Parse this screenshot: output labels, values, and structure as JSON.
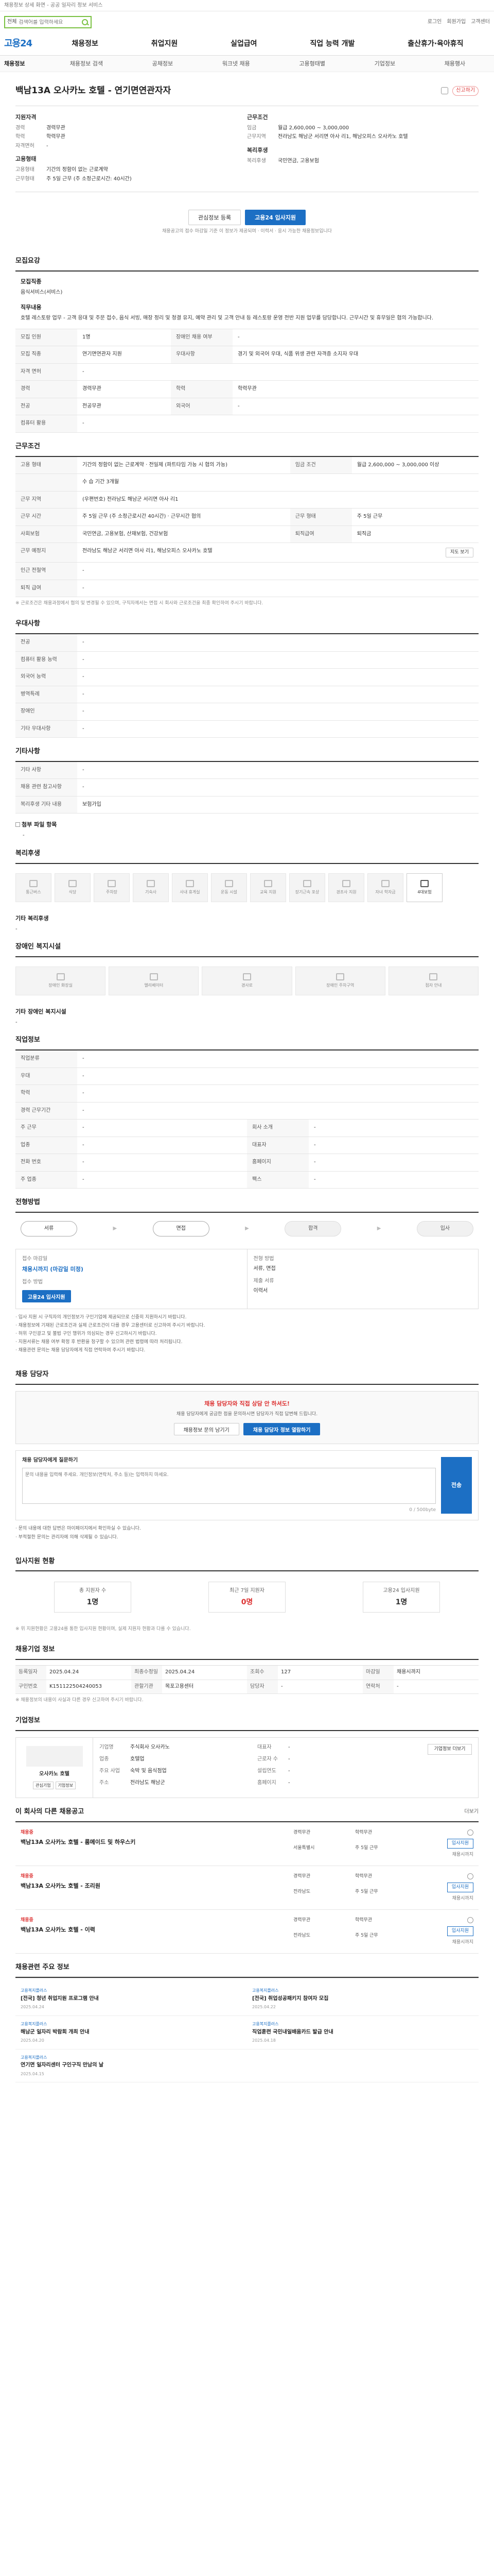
{
  "notice": "채용정보 상세 화면 - 공공 일자리 정보 서비스",
  "search": {
    "select": "전체",
    "placeholder": "검색어를 입력하세요"
  },
  "top_links": [
    "로그인",
    "회원가입",
    "고객센터"
  ],
  "logo": "고용24",
  "gnb": [
    "채용정보",
    "취업지원",
    "실업급여",
    "직업 능력 개발",
    "출산휴가·육아휴직"
  ],
  "subnav": {
    "first": "채용정보",
    "items": [
      "채용정보 검색",
      "공채정보",
      "워크넷 채용",
      "고용형태별",
      "기업정보",
      "채용행사"
    ]
  },
  "job": {
    "title": "백남13A 오사카노 호텔 - 연기면연관자자",
    "report": "신고하기",
    "summary_left_title": "지원자격",
    "summary_left": [
      {
        "k": "경력",
        "v": "경력무관"
      },
      {
        "k": "학력",
        "v": "학력무관"
      },
      {
        "k": "자격면허",
        "v": "-"
      }
    ],
    "summary_left2_title": "고용형태",
    "summary_left2": [
      {
        "k": "고용형태",
        "v": "기간의 정함이 없는 근로계약"
      },
      {
        "k": "근무형태",
        "v": "주 5일 근무 (주 소정근로시간: 40시간)"
      }
    ],
    "summary_right_title": "근무조건",
    "summary_right": [
      {
        "k": "임금",
        "v": "월급 2,600,000 ~ 3,000,000"
      },
      {
        "k": "근무지역",
        "v": "전라남도 해남군 서리면 아사 리1, 해남오피스 오사카노 호텔"
      }
    ],
    "summary_right2_title": "복리후생",
    "summary_right2": [
      {
        "k": "복리후생",
        "v": "국민연금, 고용보험"
      }
    ]
  },
  "deadline": {
    "scrap": "관심정보 등록",
    "apply": "고용24 입사지원",
    "note": "채용공고의 접수 마감일 기준 이 정보가 제공되며 · 이력서 · 응시 가능한 채용정보입니다"
  },
  "sections": {
    "recruit": "모집요강",
    "work": "근무조건",
    "welfare_detail": "우대사항",
    "etc": "기타사항",
    "welfare": "복리후생",
    "disabled": "장애인 복지시설",
    "company_form": "직업정보",
    "process": "전형방법",
    "inquiry": "채용 담당자",
    "stats": "입사지원 현황",
    "info": "채용기업 정보",
    "company": "기업정보",
    "other": "이 회사의 다른 채용공고",
    "news": "채용관련 주요 정보"
  },
  "recruit_table": {
    "job_title_label": "모집직종",
    "job_title": "음식서비스(서비스)",
    "desc_label": "직무내용",
    "desc": "호텔 레스토랑 업무 - 고객 응대 및 주문 접수, 음식 서빙, 매장 정리 및 청결 유지, 예약 관리 및 고객 안내 등 레스토랑 운영 전반 지원 업무를 담당합니다. 근무시간 및 휴무일은 협의 가능합니다.",
    "rows": [
      {
        "k1": "모집 인원",
        "v1": "1명",
        "k2": "장애인 채용 여부",
        "v2": "-"
      },
      {
        "k1": "모집 직종",
        "v1": "연기면연관자 지원",
        "k2": "우대사항",
        "v2": "경기 및 외국어 우대, 식품 위생 관련 자격증 소지자 우대"
      },
      {
        "k1": "자격 면허",
        "v1": "-",
        "k2": "",
        "v2": ""
      },
      {
        "k1": "경력",
        "v1": "경력무관",
        "k2": "학력",
        "v2": "학력무관"
      },
      {
        "k1": "전공",
        "v1": "전공무관",
        "k2": "외국어",
        "v2": "-"
      },
      {
        "k1": "컴퓨터 활용",
        "v1": "-",
        "k2": "",
        "v2": ""
      }
    ]
  },
  "work_table": {
    "rows": [
      {
        "k1": "고용 형태",
        "v1": "기간의 정함이 없는 근로계약 · 전일제 (파트타임 가능 시 협의 가능)",
        "k2": "임금 조건",
        "v2": "월급 2,600,000 ~ 3,000,000 이상"
      },
      {
        "k1": "",
        "v1": "수 습 기간 3개월",
        "k2": "",
        "v2": ""
      },
      {
        "k1": "근무 지역",
        "v1": "(우편번호) 전라남도 해남군 서리면 아사 리1",
        "k2": "",
        "v2": ""
      },
      {
        "k1": "근무 시간",
        "v1": "주 5일 근무 (주 소정근로시간 40시간) · 근무시간 협의",
        "k2": "근무 형태",
        "v2": "주 5일 근무"
      },
      {
        "k1": "사회보험",
        "v1": "국민연금, 고용보험, 산재보험, 건강보험",
        "k2": "퇴직급여",
        "v2": "퇴직금"
      },
      {
        "k1": "근무 예정지",
        "v1": "전라남도 해남군 서리면 아사 리1, 해남오피스 오사카노 호텔",
        "k2": "",
        "v2": ""
      },
      {
        "k1": "인근 전철역",
        "v1": "-",
        "k2": "",
        "v2": ""
      },
      {
        "k1": "퇴직 급여",
        "v1": "-",
        "k2": "",
        "v2": ""
      }
    ],
    "map_btn": "지도 보기",
    "note": "※ 근로조건은 채용과정에서 협의 및 변경될 수 있으며, 구직자께서는 면접 시 회사와 근로조건을 최종 확인하여 주시기 바랍니다."
  },
  "pref_table": {
    "rows": [
      {
        "k": "전공",
        "v": "-"
      },
      {
        "k": "컴퓨터 활용 능력",
        "v": "-"
      },
      {
        "k": "외국어 능력",
        "v": "-"
      },
      {
        "k": "병역특례",
        "v": "-"
      },
      {
        "k": "장애인",
        "v": "-"
      },
      {
        "k": "기타 우대사항",
        "v": "-"
      }
    ]
  },
  "etc_table": {
    "rows": [
      {
        "k": "기타 사항",
        "v": "-"
      },
      {
        "k": "채용 관련 참고사항",
        "v": "-"
      },
      {
        "k": "복리후생 기타 내용",
        "v": "보험가입"
      }
    ],
    "attach_label": "첨부 파일 항목",
    "attach": "-"
  },
  "welfare_cards": [
    "통근버스",
    "식당",
    "주차장",
    "기숙사",
    "사내 휴게실",
    "운동 시설",
    "교육 지원",
    "장기근속 포상",
    "경조사 지원",
    "자녀 학자금",
    "4대보험"
  ],
  "welfare_on": [
    10
  ],
  "welfare_note_label": "기타 복리후생",
  "welfare_note": "-",
  "disabled_cards": [
    "장애인 화장실",
    "엘리베이터",
    "경사로",
    "장애인 주차구역",
    "점자 안내"
  ],
  "disabled_note_label": "기타 장애인 복지시설",
  "disabled_note": "-",
  "company_form_rows": [
    {
      "k1": "직업분류",
      "v1": "-",
      "k2": "",
      "v2": ""
    },
    {
      "k1": "우대",
      "v1": "-",
      "k2": "",
      "v2": ""
    },
    {
      "k1": "학력",
      "v1": "-",
      "k2": "",
      "v2": ""
    },
    {
      "k1": "경력 근무기간",
      "v1": "-",
      "k2": "",
      "v2": ""
    },
    {
      "k1": "주 근무",
      "v1": "-",
      "k2": "회사 소개",
      "v2": "-"
    },
    {
      "k1": "업종",
      "v1": "-",
      "k2": "대표자",
      "v2": "-"
    },
    {
      "k1": "전화 번호",
      "v1": "-",
      "k2": "홈페이지",
      "v2": "-"
    },
    {
      "k1": "주 업종",
      "v1": "-",
      "k2": "팩스",
      "v2": "-"
    }
  ],
  "process_steps": [
    "서류",
    "면접",
    "합격",
    "입사"
  ],
  "apply": {
    "l1": "접수 마감일",
    "v1": "채용시까지 (마감일 미정)",
    "l2": "접수 방법",
    "v2": "고용24 입사지원",
    "l3": "전형 방법",
    "v3": "서류, 면접",
    "btn": "고용24 입사지원",
    "l4": "제출 서류",
    "v4": "이력서"
  },
  "apply_notes": [
    "입사 지원 시 구직자의 개인정보가 구인기업에 제공되므로 신중히 지원하시기 바랍니다.",
    "채용정보에 기재된 근로조건과 실제 근로조건이 다를 경우 고용센터로 신고하여 주시기 바랍니다.",
    "허위 구인광고 및 불법 구인 행위가 의심되는 경우 신고하시기 바랍니다.",
    "지원서류는 채용 여부 확정 후 반환을 청구할 수 있으며 관련 법령에 따라 처리됩니다.",
    "채용관련 문의는 채용 담당자에게 직접 연락하여 주시기 바랍니다."
  ],
  "inquiry": {
    "title": "채용 담당자와 직접 상담 안 하셔도!",
    "desc": "채용 담당자에게 궁금한 점을 문의하시면 담당자가 직접 답변해 드립니다.",
    "b1": "채용정보 문의 남기기",
    "b2": "채용 담당자 정보 열람하기",
    "form_label": "채용 담당자에게 질문하기",
    "placeholder": "문의 내용을 입력해 주세요. 개인정보(연락처, 주소 등)는 입력하지 마세요.",
    "count": "0 / 500byte",
    "send": "전송",
    "notes": [
      "문의 내용에 대한 답변은 마이페이지에서 확인하실 수 있습니다.",
      "부적절한 문의는 관리자에 의해 삭제될 수 있습니다."
    ]
  },
  "stats": [
    {
      "l": "총 지원자 수",
      "v": "1명",
      "hl": false
    },
    {
      "l": "최근 7일 지원자",
      "v": "0명",
      "hl": true
    },
    {
      "l": "고용24 입사지원",
      "v": "1명",
      "hl": false
    }
  ],
  "stats_note": "※ 위 지원현황은 고용24를 통한 입사지원 현황이며, 실제 지원자 현황과 다를 수 있습니다.",
  "info_rows": [
    {
      "k": "등록일자",
      "v": "2025.04.24"
    },
    {
      "k": "최종수정일",
      "v": "2025.04.24"
    },
    {
      "k": "조회수",
      "v": "127"
    },
    {
      "k": "마감일",
      "v": "채용시까지"
    },
    {
      "k": "구인번호",
      "v": "K151122504240053"
    },
    {
      "k": "관할기관",
      "v": "목포고용센터"
    },
    {
      "k": "담당자",
      "v": "-"
    },
    {
      "k": "연락처",
      "v": "-"
    }
  ],
  "info_note": "※ 채용정보의 내용이 사실과 다른 경우 신고하여 주시기 바랍니다.",
  "company": {
    "name": "오사카노 호텔",
    "btn1": "관심기업",
    "btn2": "기업정보",
    "rows": [
      {
        "k": "기업명",
        "v": "주식회사 오사카노"
      },
      {
        "k": "대표자",
        "v": "-"
      },
      {
        "k": "업종",
        "v": "호텔업"
      },
      {
        "k": "근로자 수",
        "v": "-"
      },
      {
        "k": "주요 사업",
        "v": "숙박 및 음식점업"
      },
      {
        "k": "설립연도",
        "v": "-"
      },
      {
        "k": "주소",
        "v": "전라남도 해남군"
      },
      {
        "k": "홈페이지",
        "v": "-"
      }
    ],
    "right_btn": "기업정보 더보기"
  },
  "other_more": "더보기",
  "other_jobs": [
    {
      "cat": "채용중",
      "title": "백남13A 오사카노 호텔 - 룸메이드 및 하우스키",
      "m": [
        "경력무관",
        "학력무관",
        "서울특별시",
        "주 5일 근무"
      ],
      "apply": "입사지원",
      "dd": "채용시까지"
    },
    {
      "cat": "채용중",
      "title": "백남13A 오사카노 호텔 - 조리원",
      "m": [
        "경력무관",
        "학력무관",
        "전라남도",
        "주 5일 근무"
      ],
      "apply": "입사지원",
      "dd": "채용시까지"
    },
    {
      "cat": "채용중",
      "title": "백남13A 오사카노 호텔 - 이력",
      "m": [
        "경력무관",
        "학력무관",
        "전라남도",
        "주 5일 근무"
      ],
      "apply": "입사지원",
      "dd": "채용시까지"
    }
  ],
  "news": [
    {
      "src": "고용복지플러스",
      "t": "[전국] 청년 취업지원 프로그램 안내",
      "d": "2025.04.24"
    },
    {
      "src": "고용복지플러스",
      "t": "[전국] 취업성공패키지 참여자 모집",
      "d": "2025.04.22"
    },
    {
      "src": "고용복지플러스",
      "t": "해남군 일자리 박람회 개최 안내",
      "d": "2025.04.20"
    },
    {
      "src": "고용복지플러스",
      "t": "직업훈련 국민내일배움카드 발급 안내",
      "d": "2025.04.18"
    },
    {
      "src": "고용복지플러스",
      "t": "연기면 일자리센터 구인구직 만남의 날",
      "d": "2025.04.15"
    },
    {
      "src": "",
      "t": "",
      "d": ""
    }
  ]
}
